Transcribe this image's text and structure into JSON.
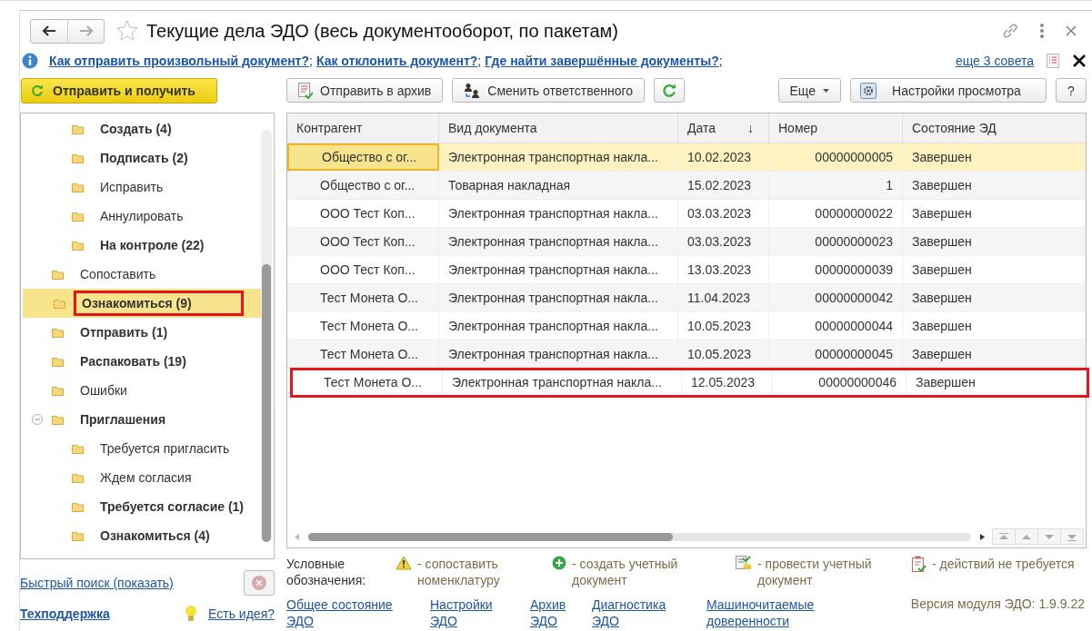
{
  "window": {
    "title": "Текущие дела ЭДО (весь документооборот, по пакетам)"
  },
  "tips": {
    "links": [
      "Как отправить произвольный документ?",
      "Как отклонить документ?",
      "Где найти завершённые документы?"
    ],
    "separator": ";",
    "more": "еще 3 совета"
  },
  "toolbar": {
    "primary": "Отправить и получить",
    "buttons": [
      {
        "kind": "archive",
        "label": "Отправить в архив"
      },
      {
        "kind": "responsible",
        "label": "Сменить ответственного"
      },
      {
        "kind": "refresh"
      }
    ],
    "more": "Еще",
    "settings": "Настройки просмотра",
    "help": "?"
  },
  "tree": {
    "continued_children": [
      {
        "label": "Создать (4)",
        "bold": true,
        "selected": false,
        "highlighted": false
      },
      {
        "label": "Подписать (2)",
        "bold": true,
        "selected": false,
        "highlighted": false
      },
      {
        "label": "Исправить",
        "bold": false,
        "selected": false,
        "highlighted": false
      },
      {
        "label": "Аннулировать",
        "bold": false,
        "selected": false,
        "highlighted": false
      },
      {
        "label": "На контроле (22)",
        "bold": true,
        "selected": false,
        "highlighted": false
      }
    ],
    "items": [
      {
        "label": "Сопоставить",
        "bold": false,
        "selected": false,
        "highlighted": false
      },
      {
        "label": "Ознакомиться (9)",
        "bold": true,
        "selected": true,
        "highlighted": true
      },
      {
        "label": "Отправить (1)",
        "bold": true,
        "selected": false,
        "highlighted": false
      },
      {
        "label": "Распаковать (19)",
        "bold": true,
        "selected": false,
        "highlighted": false
      },
      {
        "label": "Ошибки",
        "bold": false,
        "selected": false,
        "highlighted": false
      },
      {
        "label": "Приглашения",
        "bold": true,
        "selected": false,
        "highlighted": false,
        "expanded": true,
        "children": [
          {
            "label": "Требуется пригласить",
            "bold": false,
            "selected": false,
            "highlighted": false
          },
          {
            "label": "Ждем согласия",
            "bold": false,
            "selected": false,
            "highlighted": false
          },
          {
            "label": "Требуется согласие (1)",
            "bold": true,
            "selected": false,
            "highlighted": false
          },
          {
            "label": "Ознакомиться (4)",
            "bold": true,
            "selected": false,
            "highlighted": false
          }
        ]
      }
    ]
  },
  "quick_search": "Быстрый поиск (показать)",
  "support": "Техподдержка",
  "idea": "Есть идея?",
  "table": {
    "columns": [
      {
        "label": "Контрагент"
      },
      {
        "label": "Вид документа"
      },
      {
        "label": "Дата",
        "sort": "↓"
      },
      {
        "label": "Номер"
      },
      {
        "label": "Состояние ЭД"
      }
    ],
    "rows": [
      {
        "cells": [
          "Общество с ог...",
          "Электронная транспортная накла...",
          "10.02.2023",
          "00000000005",
          "Завершен"
        ],
        "selected": true,
        "highlighted": false
      },
      {
        "cells": [
          "Общество с ог...",
          "Товарная накладная",
          "15.02.2023",
          "1",
          "Завершен"
        ],
        "selected": false,
        "highlighted": false
      },
      {
        "cells": [
          "ООО Тест Коп...",
          "Электронная транспортная накла...",
          "03.03.2023",
          "00000000022",
          "Завершен"
        ],
        "selected": false,
        "highlighted": false
      },
      {
        "cells": [
          "ООО Тест Коп...",
          "Электронная транспортная накла...",
          "03.03.2023",
          "00000000023",
          "Завершен"
        ],
        "selected": false,
        "highlighted": false
      },
      {
        "cells": [
          "ООО Тест Коп...",
          "Электронная транспортная накла...",
          "13.03.2023",
          "00000000039",
          "Завершен"
        ],
        "selected": false,
        "highlighted": false
      },
      {
        "cells": [
          "Тест Монета О...",
          "Электронная транспортная накла...",
          "11.04.2023",
          "00000000042",
          "Завершен"
        ],
        "selected": false,
        "highlighted": false
      },
      {
        "cells": [
          "Тест Монета О...",
          "Электронная транспортная накла...",
          "10.05.2023",
          "00000000044",
          "Завершен"
        ],
        "selected": false,
        "highlighted": false
      },
      {
        "cells": [
          "Тест Монета О...",
          "Электронная транспортная накла...",
          "10.05.2023",
          "00000000045",
          "Завершен"
        ],
        "selected": false,
        "highlighted": false
      },
      {
        "cells": [
          "Тест Монета О...",
          "Электронная транспортная накла...",
          "12.05.2023",
          "00000000046",
          "Завершен"
        ],
        "selected": false,
        "highlighted": true
      }
    ]
  },
  "legend": {
    "title": "Условные обозначения:",
    "items": [
      {
        "kind": "warning",
        "text": "- сопоставить номенклатуру"
      },
      {
        "kind": "create",
        "text": "- создать учетный документ"
      },
      {
        "kind": "post",
        "text": "- провести учетный документ"
      },
      {
        "kind": "none",
        "text": "- действий не требуется"
      }
    ]
  },
  "footer": {
    "links": [
      "Общее состояние ЭДО",
      "Настройки ЭДО",
      "Архив ЭДО",
      "Диагностика ЭДО",
      "Машиночитаемые доверенности"
    ],
    "version": "Версия модуля ЭДО: 1.9.9.22"
  }
}
